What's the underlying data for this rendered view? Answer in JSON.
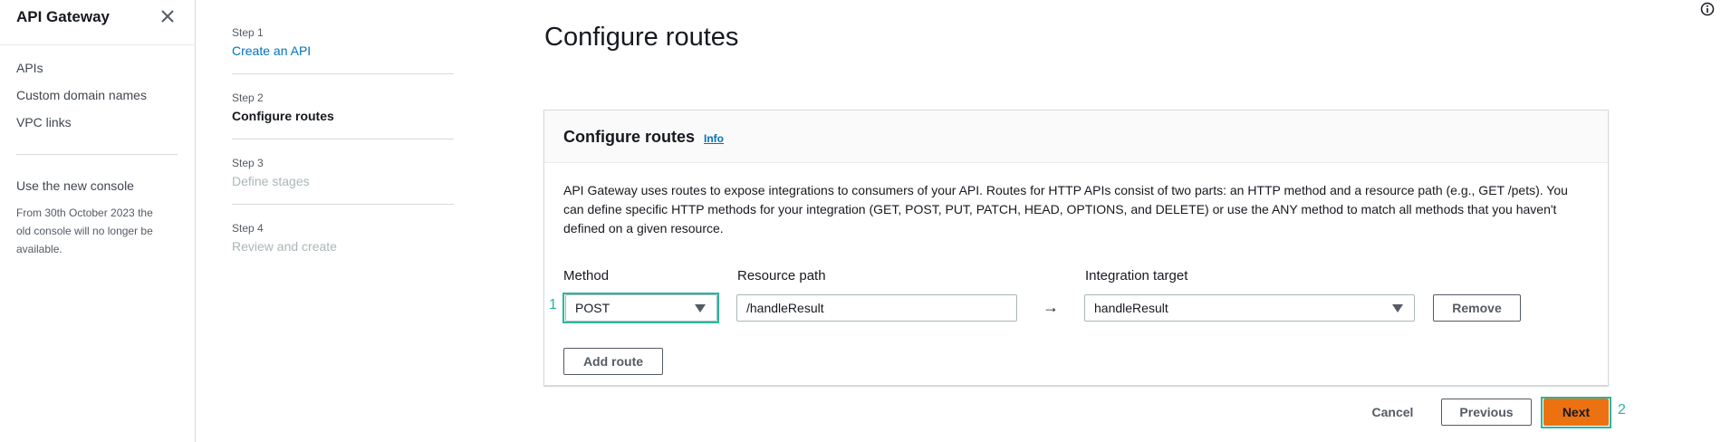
{
  "sidenav": {
    "title": "API Gateway",
    "links": [
      "APIs",
      "Custom domain names",
      "VPC links"
    ],
    "note_title": "Use the new console",
    "note_body": "From 30th October 2023 the old console will no longer be available."
  },
  "steps": [
    {
      "number": "Step 1",
      "name": "Create an API",
      "state": "link"
    },
    {
      "number": "Step 2",
      "name": "Configure routes",
      "state": "active"
    },
    {
      "number": "Step 3",
      "name": "Define stages",
      "state": "disabled"
    },
    {
      "number": "Step 4",
      "name": "Review and create",
      "state": "disabled"
    }
  ],
  "page": {
    "title": "Configure routes"
  },
  "panel": {
    "title": "Configure routes",
    "info_label": "Info",
    "description": "API Gateway uses routes to expose integrations to consumers of your API. Routes for HTTP APIs consist of two parts: an HTTP method and a resource path (e.g., GET /pets). You can define specific HTTP methods for your integration (GET, POST, PUT, PATCH, HEAD, OPTIONS, and DELETE) or use the ANY method to match all methods that you haven't defined on a given resource."
  },
  "route_form": {
    "method_label": "Method",
    "resource_path_label": "Resource path",
    "integration_target_label": "Integration target",
    "method_value": "POST",
    "resource_path_value": "/handleResult",
    "arrow": "→",
    "integration_target_value": "handleResult",
    "remove_label": "Remove",
    "add_route_label": "Add route"
  },
  "footer": {
    "cancel_label": "Cancel",
    "previous_label": "Previous",
    "next_label": "Next"
  },
  "annotations": [
    "1",
    "2"
  ],
  "colors": {
    "primary": "#ec7211",
    "link": "#0073bb",
    "annotation": "#2ab5a0"
  },
  "icons": {
    "close": "close-icon",
    "caret": "caret-down-icon",
    "help": "info-circle-icon"
  }
}
